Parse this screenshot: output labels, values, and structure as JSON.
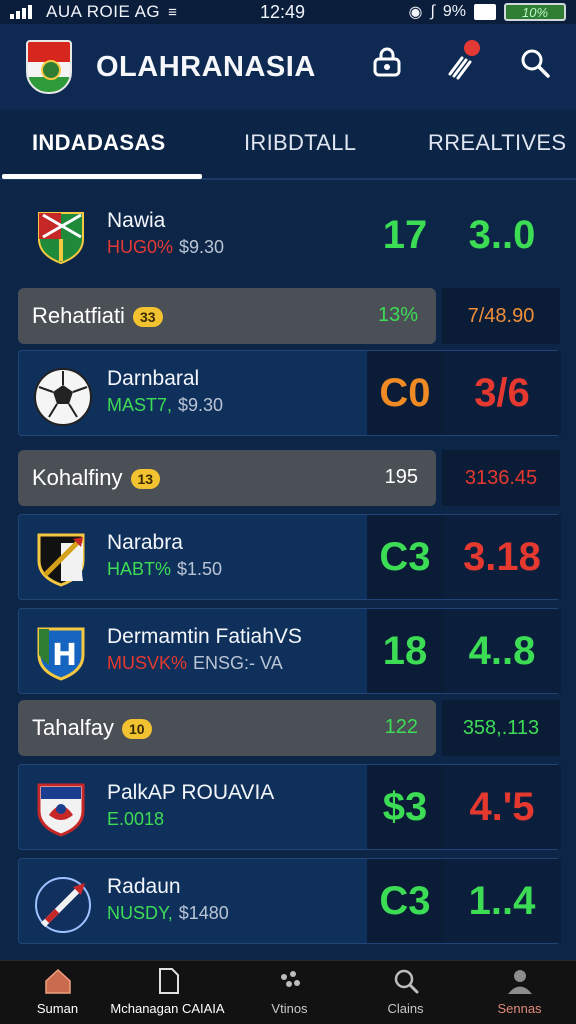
{
  "status_bar": {
    "carrier": "AUA ROIE AG",
    "time": "12:49",
    "battery_percent": "9%",
    "battery_label": "10%"
  },
  "header": {
    "title": "OLAHRANASIA"
  },
  "tabs": [
    {
      "label": "INDADASAS",
      "active": true
    },
    {
      "label": "IRIBDTALL",
      "active": false
    },
    {
      "label": "RREALTIVES",
      "active": false
    }
  ],
  "rows": [
    {
      "kind": "match",
      "name": "Nawia",
      "pct": "HUG0%",
      "pct_color": "#e53935",
      "value": "$9.30",
      "score": "17",
      "score_color": "#3ddc55",
      "odd": "3..0",
      "odd_color": "#3ddc55",
      "crest": "shield-flag"
    },
    {
      "kind": "section",
      "title": "Rehatfiati",
      "count": "33",
      "mid": "13%",
      "mid_color": "#3ddc55",
      "total": "7/48.90",
      "total_color": "#ef8f3a"
    },
    {
      "kind": "match",
      "name": "Darnbaral",
      "pct": "MAST7,",
      "pct_color": "#3ddc55",
      "value": "$9.30",
      "score": "C0",
      "score_color": "#f08a24",
      "odd": "3/6",
      "odd_color": "#e5392f",
      "crest": "soccer-ball"
    },
    {
      "kind": "section",
      "title": "Kohalfiny",
      "count": "13",
      "mid": "195",
      "mid_color": "#ffffff",
      "total": "3136.45",
      "total_color": "#e5392f"
    },
    {
      "kind": "match",
      "name": "Narabra",
      "pct": "HABT%",
      "pct_color": "#3ddc55",
      "value": "$1.50",
      "score": "C3",
      "score_color": "#3ddc55",
      "odd": "3.18",
      "odd_color": "#e5392f",
      "crest": "shield-sword"
    },
    {
      "kind": "match",
      "name": "Dermamtin FatiahVS",
      "pct": "MUSVK%",
      "pct_color": "#e5392f",
      "value": "ENSG:- VA",
      "score": "18",
      "score_color": "#3ddc55",
      "odd": "4..8",
      "odd_color": "#3ddc55",
      "crest": "shield-h"
    },
    {
      "kind": "section",
      "title": "Tahalfay",
      "count": "10",
      "mid": "122",
      "mid_color": "#3ddc55",
      "total": "358,.113",
      "total_color": "#3ddc55"
    },
    {
      "kind": "match",
      "name": "PalkAP ROUAVIA",
      "pct": "E.0018",
      "pct_color": "#3ddc55",
      "value": "",
      "score": "$3",
      "score_color": "#3ddc55",
      "odd": "4.'5",
      "odd_color": "#e5392f",
      "crest": "shield-eagle"
    },
    {
      "kind": "match",
      "name": "Radaun",
      "pct": "NUSDY,",
      "pct_color": "#3ddc55",
      "value": "$1480",
      "score": "C3",
      "score_color": "#3ddc55",
      "odd": "1..4",
      "odd_color": "#3ddc55",
      "crest": "ball-dart"
    }
  ],
  "bottom_nav": [
    {
      "label": "Suman",
      "icon": "home-icon",
      "color": "#ffffff"
    },
    {
      "label": "Mchanagan CAIAIA",
      "icon": "document-icon",
      "color": "#ffffff"
    },
    {
      "label": "Vtinos",
      "icon": "puzzle-icon",
      "color": "#c9c9c9"
    },
    {
      "label": "Clains",
      "icon": "search-icon",
      "color": "#c9c9c9"
    },
    {
      "label": "Sennas",
      "icon": "profile-icon",
      "color": "#e08a7a"
    }
  ]
}
